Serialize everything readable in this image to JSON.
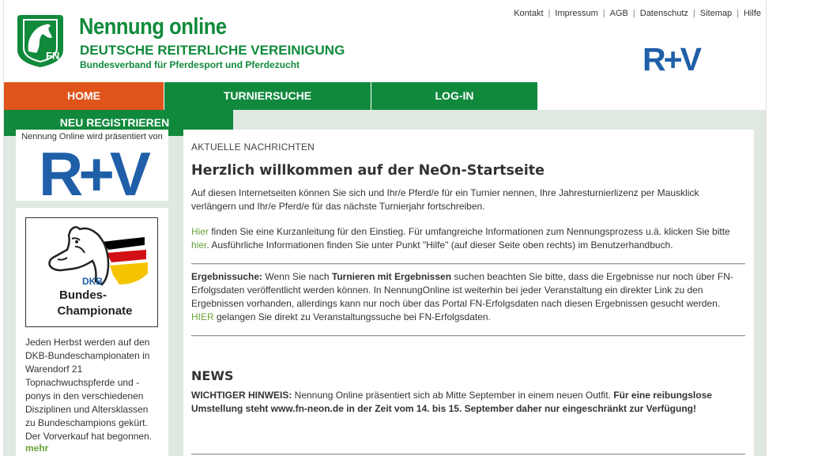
{
  "header": {
    "brand_title": "Nennung online",
    "brand_subtitle": "DEUTSCHE REITERLICHE VEREINIGUNG",
    "brand_tagline": "Bundesverband für Pferdesport und Pferdezucht",
    "fn_logo_text": "FN",
    "sponsor_logo_text": "R+V"
  },
  "topnav": {
    "kontakt": "Kontakt",
    "impressum": "Impressum",
    "agb": "AGB",
    "datenschutz": "Datenschutz",
    "sitemap": "Sitemap",
    "hilfe": "Hilfe",
    "separator": "|"
  },
  "mainnav": {
    "home": "HOME",
    "turniersuche": "TURNIERSUCHE",
    "login": "LOG-IN",
    "register": "NEU REGISTRIEREN"
  },
  "sidebar": {
    "sponsor_label": "Nennung Online wird präsentiert von",
    "sponsor_logo_text": "R+V",
    "dkb": {
      "logo_line1": "DKB",
      "logo_line2": "Bundes-",
      "logo_line3": "Championate",
      "text": "Jeden Herbst werden auf den DKB-Bundeschampionaten in Warendorf 21 Topnachwuchspferde und -ponys in den verschiedenen Disziplinen und Altersklassen zu Bundeschampions gekürt. Der Vorverkauf hat begonnen.",
      "more": "mehr"
    }
  },
  "content": {
    "kicker": "AKTUELLE NACHRICHTEN",
    "welcome_title": "Herzlich willkommen auf der NeOn-Startseite",
    "p1": "Auf diesen Internetseiten können Sie sich und Ihr/e Pferd/e für ein Turnier nennen, Ihre Jahresturnierlizenz per Mausklick verlängern und Ihr/e Pferd/e für das nächste Turnierjahr fortschreiben.",
    "p2_link1": "Hier",
    "p2_a": " finden Sie eine Kurzanleitung für den Einstieg. Für umfangreiche Informationen zum Nennungsprozess u.ä. klicken Sie bitte ",
    "p2_link2": "hier",
    "p2_b": ". Ausführliche Informationen finden Sie unter Punkt \"Hilfe\" (auf dieser Seite oben rechts) im Benutzerhandbuch.",
    "p3_label": "Ergebnissuche:",
    "p3_a": " Wenn Sie nach ",
    "p3_bold": "Turnieren mit Ergebnissen",
    "p3_b": " suchen beachten Sie bitte, dass die Ergebnisse nur noch über FN-Erfolgsdaten veröffentlicht werden können. In NennungOnline ist weiterhin bei jeder Veranstaltung ein direkter Link zu den Ergebnissen vorhanden, allerdings kann nur noch über das Portal FN-Erfolgsdaten nach diesen Ergebnissen gesucht werden.",
    "p3_link": "HIER",
    "p3_c": " gelangen Sie direkt zu Veranstaltungssuche bei FN-Erfolgsdaten.",
    "news_title": "NEWS",
    "p4_label": "WICHTIGER HINWEIS:",
    "p4_a": " Nennung Online präsentiert sich ab Mitte September in einem neuen Outfit. ",
    "p4_bold": "Für eine reibungslose Umstellung steht www.fn-neon.de in der Zeit vom 14. bis 15. September daher nur eingeschränkt zur Verfügung!"
  },
  "colors": {
    "brand_green": "#118a3c",
    "home_orange": "#e0541c",
    "link_green": "#6aa23a",
    "band_green": "#dfe9e1",
    "rv_blue": "#1f5fa8"
  }
}
